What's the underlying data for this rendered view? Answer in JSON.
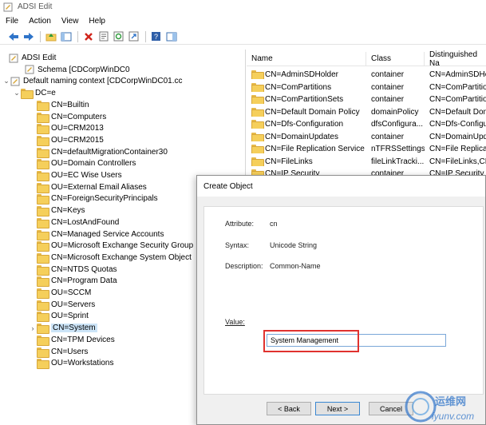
{
  "window": {
    "title": "ADSI Edit"
  },
  "menu": [
    "File",
    "Action",
    "View",
    "Help"
  ],
  "tree": {
    "root": "ADSI Edit",
    "schema": "Schema [CDCorpWinDC0",
    "default_nc": "Default naming context [CDCorpWinDC01.cc",
    "domain": "DC=e",
    "children": [
      "CN=Builtin",
      "CN=Computers",
      "OU=CRM2013",
      "OU=CRM2015",
      "CN=defaultMigrationContainer30",
      "OU=Domain Controllers",
      "OU=EC Wise Users",
      "OU=External Email Aliases",
      "CN=ForeignSecurityPrincipals",
      "CN=Keys",
      "CN=LostAndFound",
      "CN=Managed Service Accounts",
      "OU=Microsoft Exchange Security Group",
      "CN=Microsoft Exchange System Object",
      "CN=NTDS Quotas",
      "CN=Program Data",
      "OU=SCCM",
      "OU=Servers",
      "OU=Sprint",
      "CN=System",
      "CN=TPM Devices",
      "CN=Users",
      "OU=Workstations"
    ],
    "selected_index": 19
  },
  "list": {
    "columns": [
      "Name",
      "Class",
      "Distinguished Na"
    ],
    "rows": [
      {
        "name": "CN=AdminSDHolder",
        "class": "container",
        "dn": "CN=AdminSDHolder"
      },
      {
        "name": "CN=ComPartitions",
        "class": "container",
        "dn": "CN=ComPartitio"
      },
      {
        "name": "CN=ComPartitionSets",
        "class": "container",
        "dn": "CN=ComPartitio"
      },
      {
        "name": "CN=Default Domain Policy",
        "class": "domainPolicy",
        "dn": "CN=Default Dom"
      },
      {
        "name": "CN=Dfs-Configuration",
        "class": "dfsConfigura...",
        "dn": "CN=Dfs-Configu"
      },
      {
        "name": "CN=DomainUpdates",
        "class": "container",
        "dn": "CN=DomainUpd"
      },
      {
        "name": "CN=File Replication Service",
        "class": "nTFRSSettings",
        "dn": "CN=File Replicat"
      },
      {
        "name": "CN=FileLinks",
        "class": "fileLinkTracki...",
        "dn": "CN=FileLinks,CN"
      },
      {
        "name": "CN=IP Security",
        "class": "container",
        "dn": "CN=IP Security"
      }
    ]
  },
  "dialog": {
    "title": "Create Object",
    "attribute_label": "Attribute:",
    "attribute_value": "cn",
    "syntax_label": "Syntax:",
    "syntax_value": "Unicode String",
    "description_label": "Description:",
    "description_value": "Common-Name",
    "value_label": "Value:",
    "value_input": "System Management",
    "back_button": "< Back",
    "next_button": "Next >",
    "cancel_button": "Cancel"
  },
  "watermark": {
    "text": "运维网",
    "subtext": "iyunv.com"
  },
  "colors": {
    "accent": "#3a87d1",
    "highlight": "#e0322f",
    "folder": "#f5cf5b",
    "selection": "#cce4f7"
  }
}
